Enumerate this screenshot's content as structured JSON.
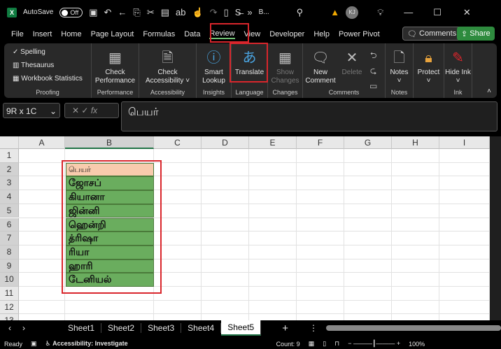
{
  "titlebar": {
    "autosave": "AutoSave",
    "toggle": "Off",
    "filename": "B...",
    "avatar": "KJ"
  },
  "tabs": [
    "File",
    "Insert",
    "Home",
    "Page Layout",
    "Formulas",
    "Data",
    "Review",
    "View",
    "Developer",
    "Help",
    "Power Pivot"
  ],
  "active_tab": "Review",
  "comments_btn": "Comments",
  "share_btn": "Share",
  "ribbon": {
    "proofing": {
      "items": [
        "Spelling",
        "Thesaurus",
        "Workbook Statistics"
      ],
      "label": "Proofing"
    },
    "performance": {
      "btn": "Check Performance",
      "label": "Performance"
    },
    "accessibility": {
      "btn": "Check Accessibility",
      "label": "Accessibility"
    },
    "insights": {
      "btn": "Smart Lookup",
      "label": "Insights"
    },
    "language": {
      "btn": "Translate",
      "label": "Language"
    },
    "changes": {
      "btn": "Show Changes",
      "label": "Changes"
    },
    "comments": {
      "new": "New Comment",
      "delete": "Delete",
      "label": "Comments"
    },
    "notes": {
      "btn": "Notes",
      "label": "Notes"
    },
    "protect": {
      "btn": "Protect"
    },
    "ink": {
      "btn": "Hide Ink",
      "label": "Ink"
    }
  },
  "namebox": "9R x 1C",
  "fx": "fx",
  "formula": "பெயர்",
  "columns": [
    "A",
    "B",
    "C",
    "D",
    "E",
    "F",
    "G",
    "H",
    "I"
  ],
  "rows": [
    "1",
    "2",
    "3",
    "4",
    "5",
    "6",
    "7",
    "8",
    "9",
    "10",
    "11",
    "12",
    "13"
  ],
  "header_cell": "பெயர்",
  "names": [
    "ஜோசப்",
    "கியானா",
    "ஜின்னி",
    "ஹென்றி",
    "த்ரிஷா",
    "ரியா",
    "ஹாரி",
    "டேனியல்"
  ],
  "colors": {
    "header_fill": "#f8cbad",
    "data_fill": "#6aad5e",
    "highlight": "#d9262c"
  },
  "sheets": [
    "Sheet1",
    "Sheet2",
    "Sheet3",
    "Sheet4",
    "Sheet5"
  ],
  "active_sheet": "Sheet5",
  "status": {
    "ready": "Ready",
    "accessibility": "Accessibility: Investigate",
    "count": "Count: 9",
    "zoom": "100%"
  }
}
